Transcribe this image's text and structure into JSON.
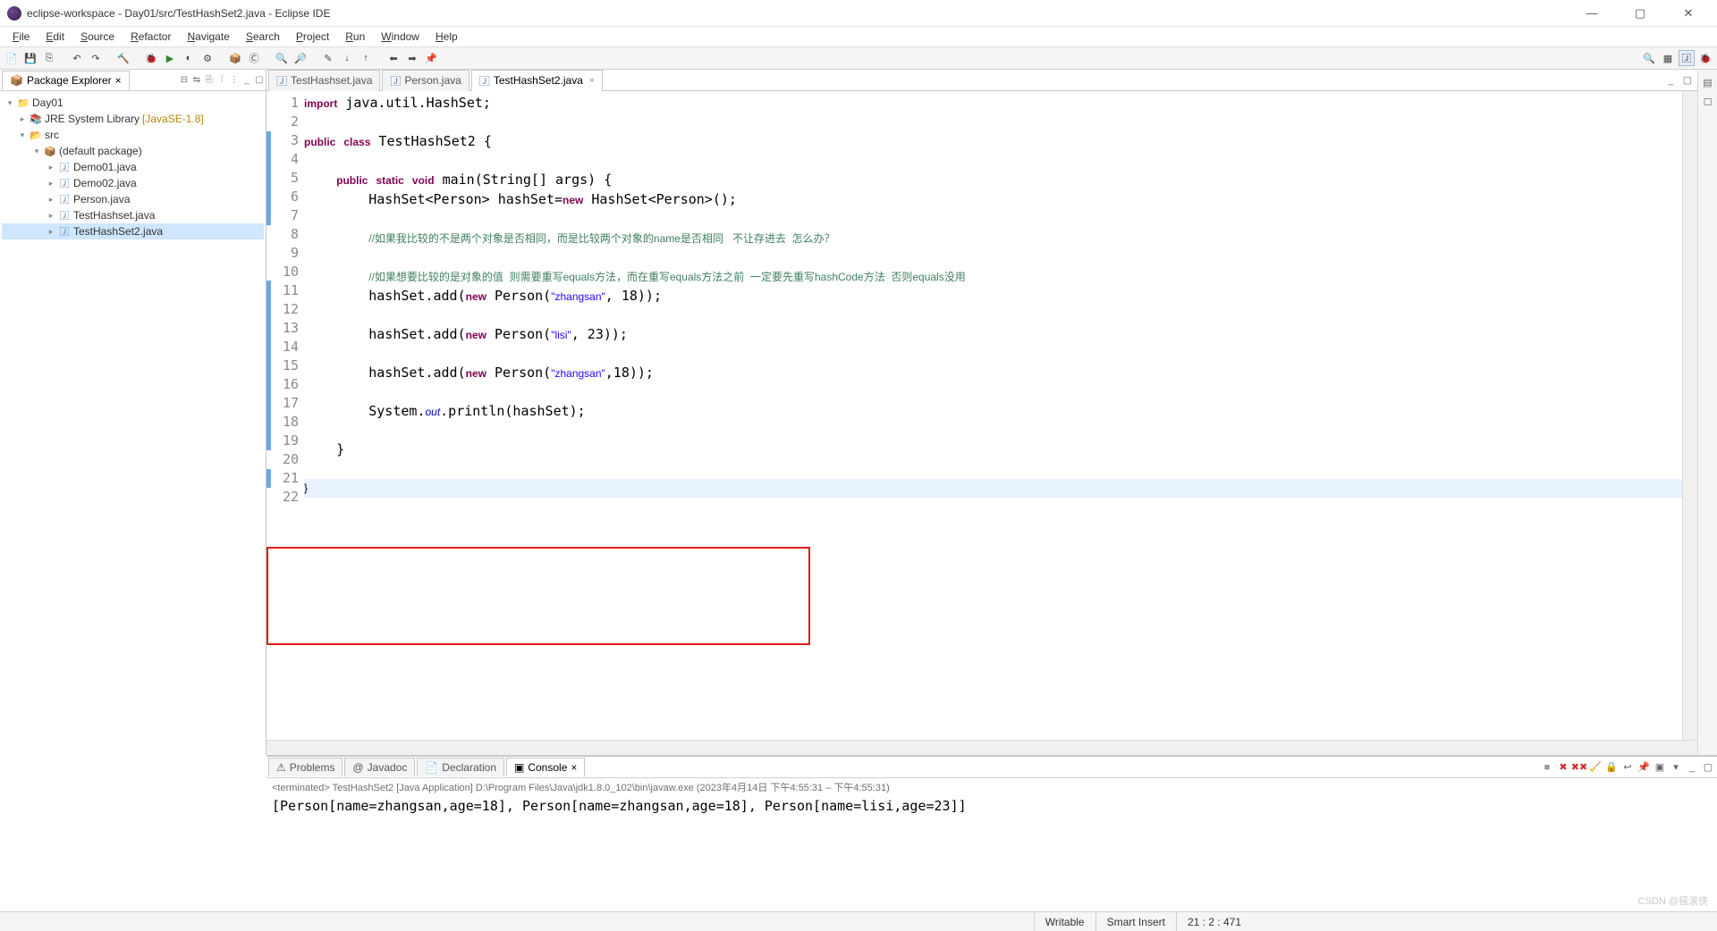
{
  "window": {
    "title": "eclipse-workspace - Day01/src/TestHashSet2.java - Eclipse IDE"
  },
  "menubar": [
    "File",
    "Edit",
    "Source",
    "Refactor",
    "Navigate",
    "Search",
    "Project",
    "Run",
    "Window",
    "Help"
  ],
  "package_explorer": {
    "title": "Package Explorer",
    "project": "Day01",
    "jre": "JRE System Library",
    "jre_ver": "[JavaSE-1.8]",
    "src": "src",
    "pkg": "(default package)",
    "files": [
      "Demo01.java",
      "Demo02.java",
      "Person.java",
      "TestHashset.java",
      "TestHashSet2.java"
    ]
  },
  "editor_tabs": [
    {
      "label": "TestHashset.java",
      "active": false
    },
    {
      "label": "Person.java",
      "active": false
    },
    {
      "label": "TestHashSet2.java",
      "active": true
    }
  ],
  "code_lines": [
    {
      "n": 1,
      "html": "<span class='kw'>import</span> java.util.HashSet;"
    },
    {
      "n": 2,
      "html": ""
    },
    {
      "n": 3,
      "html": "<span class='kw'>public</span> <span class='kw'>class</span> TestHashSet2 {"
    },
    {
      "n": 4,
      "html": ""
    },
    {
      "n": 5,
      "html": "    <span class='kw'>public</span> <span class='kw'>static</span> <span class='kw'>void</span> main(String[] args) {"
    },
    {
      "n": 6,
      "html": "        HashSet&lt;Person&gt; hashSet=<span class='kw'>new</span> HashSet&lt;Person&gt;();"
    },
    {
      "n": 7,
      "html": ""
    },
    {
      "n": 8,
      "html": "        <span class='cmt'>//如果我比较的不是两个对象是否相同，而是比较两个对象的name是否相同   不让存进去  怎么办？</span>"
    },
    {
      "n": 9,
      "html": ""
    },
    {
      "n": 10,
      "html": "        <span class='cmt'>//如果想要比较的是对象的值  则需要重写equals方法，而在重写equals方法之前  一定要先重写hashCode方法  否则equals没用</span>"
    },
    {
      "n": 11,
      "html": "        hashSet.add(<span class='kw'>new</span> Person(<span class='str'>\"zhangsan\"</span>, 18));"
    },
    {
      "n": 12,
      "html": ""
    },
    {
      "n": 13,
      "html": "        hashSet.add(<span class='kw'>new</span> Person(<span class='str'>\"lisi\"</span>, 23));"
    },
    {
      "n": 14,
      "html": ""
    },
    {
      "n": 15,
      "html": "        hashSet.add(<span class='kw'>new</span> Person(<span class='str'>\"zhangsan\"</span>,18));"
    },
    {
      "n": 16,
      "html": ""
    },
    {
      "n": 17,
      "html": "        System.<span class='fld'>out</span>.println(hashSet);"
    },
    {
      "n": 18,
      "html": ""
    },
    {
      "n": 19,
      "html": "    }"
    },
    {
      "n": 20,
      "html": ""
    },
    {
      "n": 21,
      "html": "}",
      "current": true
    },
    {
      "n": 22,
      "html": ""
    }
  ],
  "bottom_tabs": [
    {
      "label": "Problems",
      "icon": "⚠"
    },
    {
      "label": "Javadoc",
      "icon": "@"
    },
    {
      "label": "Declaration",
      "icon": "📄"
    },
    {
      "label": "Console",
      "icon": "▣",
      "active": true,
      "closable": true
    }
  ],
  "console": {
    "header": "<terminated> TestHashSet2 [Java Application] D:\\Program Files\\Java\\jdk1.8.0_102\\bin\\javaw.exe  (2023年4月14日 下午4:55:31 – 下午4:55:31)",
    "output": "[Person[name=zhangsan,age=18], Person[name=zhangsan,age=18], Person[name=lisi,age=23]]"
  },
  "statusbar": {
    "writable": "Writable",
    "insert": "Smart Insert",
    "pos": "21 : 2 : 471"
  },
  "watermark": "CSDN @摇滚侠"
}
